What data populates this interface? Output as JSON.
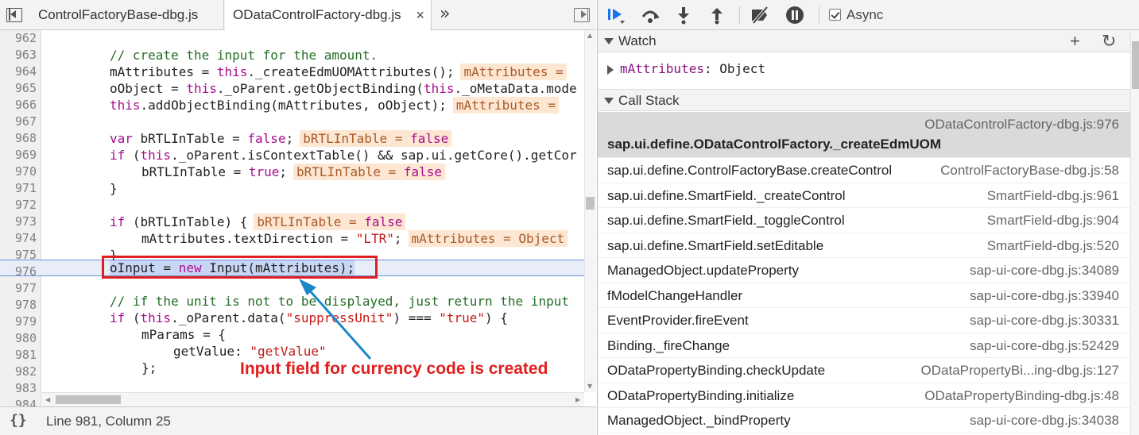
{
  "tabs": [
    {
      "label": "ControlFactoryBase-dbg.js"
    },
    {
      "label": "ODataControlFactory-dbg.js",
      "close": "×"
    }
  ],
  "more_tabs": "»",
  "editor": {
    "lines": [
      {
        "n": "962",
        "text": ""
      },
      {
        "n": "963",
        "text": ""
      },
      {
        "n": "964",
        "text": ""
      },
      {
        "n": "965",
        "text": ""
      },
      {
        "n": "966",
        "text": ""
      },
      {
        "n": "967",
        "text": ""
      },
      {
        "n": "968",
        "text": ""
      },
      {
        "n": "969",
        "text": ""
      },
      {
        "n": "970",
        "text": ""
      },
      {
        "n": "971",
        "text": ""
      },
      {
        "n": "972",
        "text": ""
      },
      {
        "n": "973",
        "text": ""
      },
      {
        "n": "974",
        "text": ""
      },
      {
        "n": "975",
        "text": ""
      },
      {
        "n": "976",
        "text": ""
      },
      {
        "n": "977",
        "text": ""
      },
      {
        "n": "978",
        "text": ""
      },
      {
        "n": "979",
        "text": ""
      },
      {
        "n": "980",
        "text": ""
      },
      {
        "n": "981",
        "text": ""
      },
      {
        "n": "982",
        "text": ""
      },
      {
        "n": "983",
        "text": ""
      },
      {
        "n": "984",
        "text": ""
      }
    ],
    "code": {
      "l963": "// create the input for the amount.",
      "l964_a": "mAttributes = ",
      "l964_kw": "this",
      "l964_b": "._createEdmUOMAttributes();",
      "l964_iv": "mAttributes =",
      "l965_a": "oObject = ",
      "l965_kw1": "this",
      "l965_b": "._oParent.getObjectBinding(",
      "l965_kw2": "this",
      "l965_c": "._oMetaData.mode",
      "l966_kw": "this",
      "l966_b": ".addObjectBinding(mAttributes, oObject);",
      "l966_iv": "mAttributes =",
      "l968_kw": "var",
      "l968_b": " bRTLInTable = ",
      "l968_f": "false",
      "l968_c": ";",
      "l968_iv_k": "bRTLInTable = ",
      "l968_iv_v": "false",
      "l969_kw": "if",
      "l969_b": " (",
      "l969_kw2": "this",
      "l969_c": "._oParent.isContextTable() && sap.ui.getCore().getCor",
      "l970_a": "bRTLInTable = ",
      "l970_t": "true",
      "l970_b": ";",
      "l970_iv_k": "bRTLInTable = ",
      "l970_iv_v": "false",
      "l971": "}",
      "l973_kw": "if",
      "l973_b": " (bRTLInTable) {",
      "l973_iv_k": "bRTLInTable = ",
      "l973_iv_v": "false",
      "l974_a": "mAttributes.textDirection = ",
      "l974_s": "\"LTR\"",
      "l974_b": ";",
      "l974_iv": "mAttributes = Object",
      "l975": "}",
      "l976_a": "oInput = ",
      "l976_kw": "new",
      "l976_b": " Input(mAttributes);",
      "l978": "// if the unit is not to be displayed, just return the input",
      "l979_kw": "if",
      "l979_b": " (",
      "l979_kw2": "this",
      "l979_c": "._oParent.data(",
      "l979_s1": "\"suppressUnit\"",
      "l979_d": ") === ",
      "l979_s2": "\"true\"",
      "l979_e": ") {",
      "l980": "mParams = {",
      "l981_a": "getValue: ",
      "l981_s": "\"getValue\"",
      "l982": "};"
    },
    "annotation": "Input field for currency code is created"
  },
  "status": {
    "pretty_print": "{}",
    "cursor": "Line 981, Column 25"
  },
  "debugger": {
    "async_label": "Async",
    "async_checked": true,
    "watch": {
      "title": "Watch",
      "add": "+",
      "refresh": "↻",
      "name": "mAttributes",
      "sep": ": ",
      "value": "Object"
    },
    "call_stack": {
      "title": "Call Stack",
      "frames": [
        {
          "fn": "sap.ui.define.ODataControlFactory._createEdmUOM",
          "loc": "ODataControlFactory-dbg.js:976"
        },
        {
          "fn": "sap.ui.define.ControlFactoryBase.createControl",
          "loc": "ControlFactoryBase-dbg.js:58"
        },
        {
          "fn": "sap.ui.define.SmartField._createControl",
          "loc": "SmartField-dbg.js:961"
        },
        {
          "fn": "sap.ui.define.SmartField._toggleControl",
          "loc": "SmartField-dbg.js:904"
        },
        {
          "fn": "sap.ui.define.SmartField.setEditable",
          "loc": "SmartField-dbg.js:520"
        },
        {
          "fn": "ManagedObject.updateProperty",
          "loc": "sap-ui-core-dbg.js:34089"
        },
        {
          "fn": "fModelChangeHandler",
          "loc": "sap-ui-core-dbg.js:33940"
        },
        {
          "fn": "EventProvider.fireEvent",
          "loc": "sap-ui-core-dbg.js:30331"
        },
        {
          "fn": "Binding._fireChange",
          "loc": "sap-ui-core-dbg.js:52429"
        },
        {
          "fn": "ODataPropertyBinding.checkUpdate",
          "loc": "ODataPropertyBi...ing-dbg.js:127"
        },
        {
          "fn": "ODataPropertyBinding.initialize",
          "loc": "ODataPropertyBinding-dbg.js:48"
        },
        {
          "fn": "ManagedObject._bindProperty",
          "loc": "sap-ui-core-dbg.js:34038"
        }
      ]
    }
  },
  "colors": {
    "comment": "#236e25",
    "keyword": "#aa0d91",
    "string": "#c41a16",
    "inline_value_bg": "#fde6d2",
    "exec_line": "#e8edf9",
    "annotation": "#e02020",
    "resume_icon": "#1a73e8"
  },
  "icons": [
    "navigator-toggle-icon",
    "more-tabs-icon",
    "debugger-toggle-icon",
    "resume-icon",
    "step-over-icon",
    "step-into-icon",
    "step-out-icon",
    "deactivate-breakpoints-icon",
    "pause-on-exceptions-icon",
    "add-watch-icon",
    "refresh-watch-icon"
  ]
}
